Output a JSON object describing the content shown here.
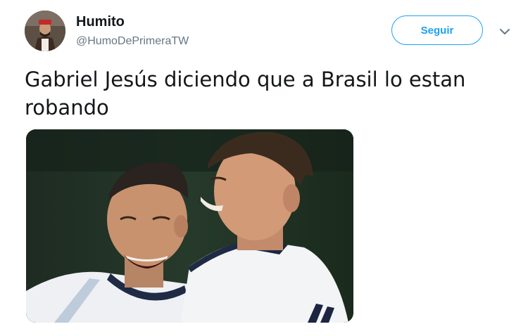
{
  "tweet": {
    "author": {
      "display_name": "Humito",
      "handle": "@HumoDePrimeraTW"
    },
    "follow_label": "Seguir",
    "text": "Gabriel Jesús diciendo que a Brasil lo estan robando",
    "media_icon": "photo",
    "more_icon": "chevron-down-icon",
    "colors": {
      "accent": "#1da1f2",
      "text": "#14171a",
      "secondary_text": "#657786"
    }
  }
}
